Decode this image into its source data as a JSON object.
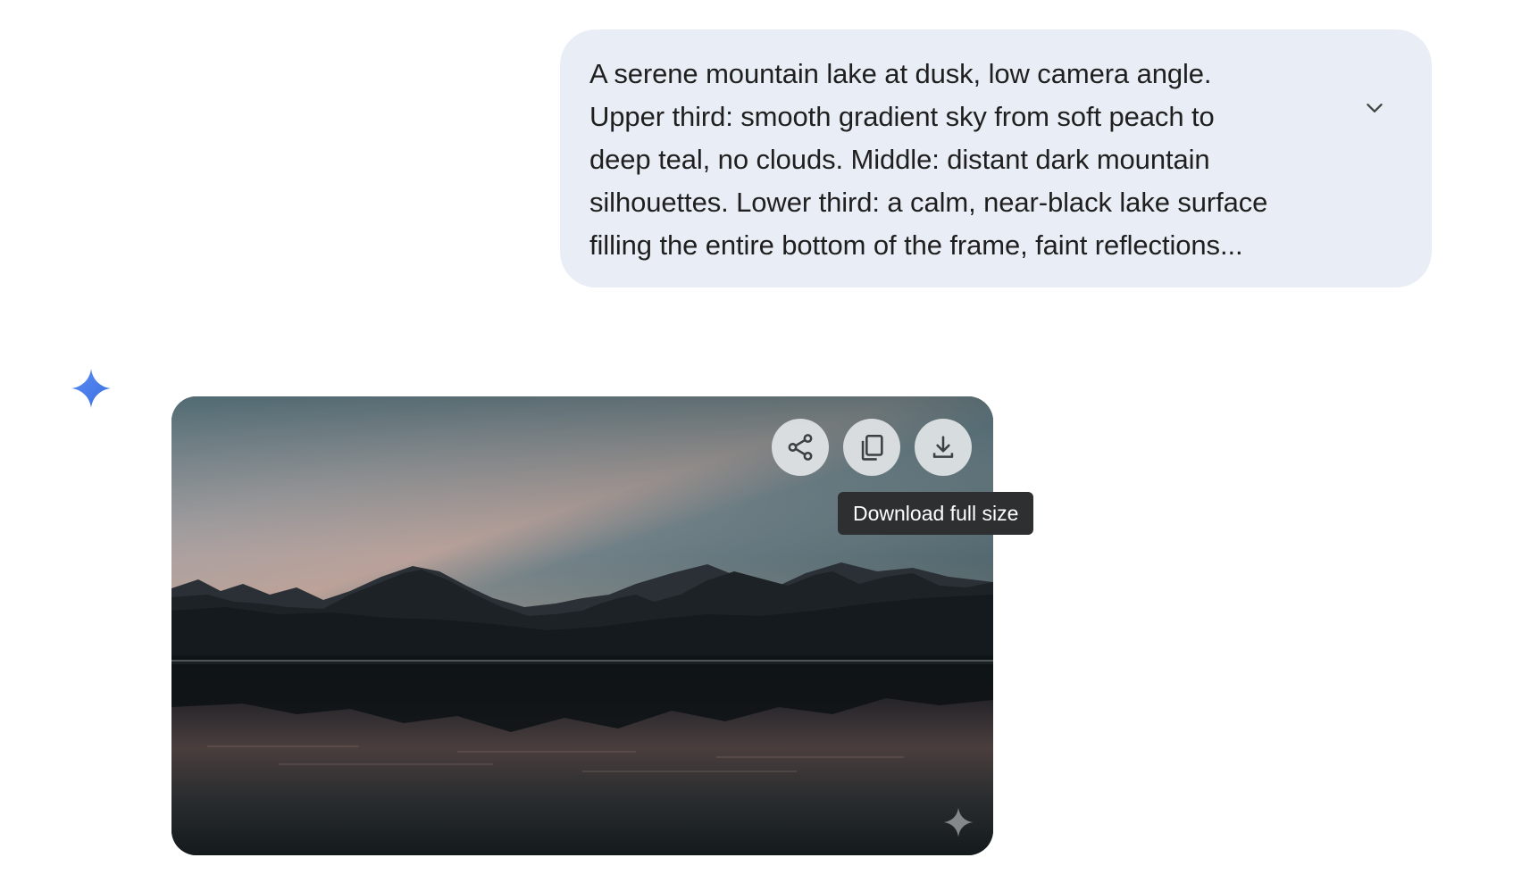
{
  "prompt": {
    "text": "A serene mountain lake at dusk, low camera angle.\nUpper third: smooth gradient sky from soft peach to\ndeep teal, no clouds. Middle: distant dark mountain\nsilhouettes. Lower third: a calm, near-black lake surface\nfilling the entire bottom of the frame, faint reflections...",
    "toggle_icon": "chevron-down-icon"
  },
  "assistant": {
    "avatar_icon": "sparkle-icon",
    "avatar_color": "#4a7ff0"
  },
  "image": {
    "actions": [
      {
        "id": "share",
        "icon": "share-icon"
      },
      {
        "id": "copy",
        "icon": "copy-icon"
      },
      {
        "id": "download",
        "icon": "download-icon"
      }
    ],
    "watermark_icon": "sparkle-icon",
    "tooltip": "Download full size"
  },
  "colors": {
    "prompt_bubble": "#e9eef6",
    "tooltip_bg": "#2d2f31",
    "action_bg": "#e2e5e7"
  }
}
